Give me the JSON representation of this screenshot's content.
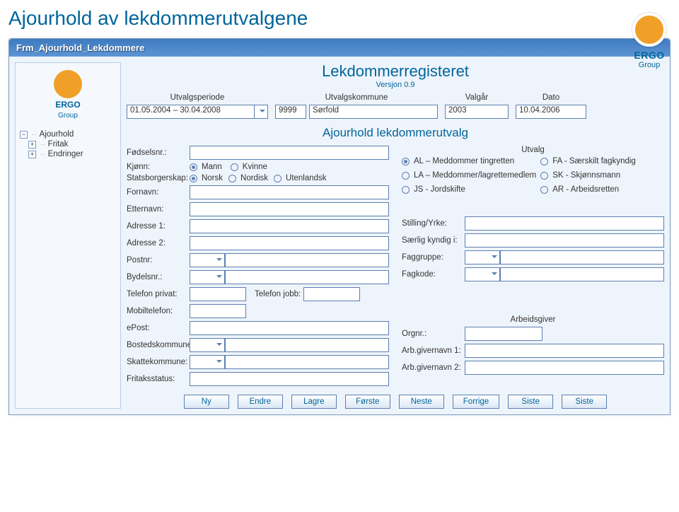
{
  "page": {
    "title": "Ajourhold av lekdommerutvalgene"
  },
  "brand": {
    "name": "ΕRGO",
    "sub": "Group"
  },
  "window": {
    "title": "Frm_Ajourhold_Lekdommere"
  },
  "app": {
    "title": "Lekdommerregisteret",
    "version": "Versjon 0.9"
  },
  "tree": {
    "root": "Ajourhold",
    "n1": "Fritak",
    "n2": "Endringer"
  },
  "header": {
    "labels": {
      "periode": "Utvalgsperiode",
      "kommune": "Utvalgskommune",
      "valgar": "Valgår",
      "dato": "Dato"
    },
    "values": {
      "periode": "01.05.2004 – 30.04.2008",
      "kommune_code": "9999",
      "kommune_name": "Sørfold",
      "valgar": "2003",
      "dato": "10.04.2006"
    }
  },
  "section": {
    "title": "Ajourhold lekdommerutvalg"
  },
  "utvalg": {
    "label": "Utvalg",
    "opts": {
      "al": "AL – Meddommer tingretten",
      "la": "LA – Meddommer/lagrettemedlem",
      "js": "JS - Jordskifte",
      "fa": "FA - Særskilt fagkyndig",
      "sk": "SK - Skjønnsmann",
      "ar": "AR - Arbeidsretten"
    }
  },
  "fields": {
    "fodselsnr": "Fødselsnr.:",
    "kjonn": "Kjønn:",
    "kjonn_mann": "Mann",
    "kjonn_kvinne": "Kvinne",
    "stats": "Statsborgerskap:",
    "stats_norsk": "Norsk",
    "stats_nordisk": "Nordisk",
    "stats_utl": "Utenlandsk",
    "fornavn": "Fornavn:",
    "etternavn": "Etternavn:",
    "adr1": "Adresse 1:",
    "adr2": "Adresse 2:",
    "postnr": "Postnr:",
    "bydel": "Bydelsnr.:",
    "telpriv": "Telefon privat:",
    "teljobb": "Telefon jobb:",
    "mobil": "Mobiltelefon:",
    "epost": "ePost:",
    "bosted": "Bostedskommune:",
    "skatte": "Skattekommune:",
    "fritak": "Fritaksstatus:",
    "stilling": "Stilling/Yrke:",
    "saerlig": "Særlig kyndig i:",
    "faggruppe": "Faggruppe:",
    "fagkode": "Fagkode:",
    "arbeidsgiver": "Arbeidsgiver",
    "orgnr": "Orgnr.:",
    "arbg1": "Arb.givernavn 1:",
    "arbg2": "Arb.givernavn 2:"
  },
  "buttons": {
    "ny": "Ny",
    "endre": "Endre",
    "lagre": "Lagre",
    "forste": "Første",
    "neste": "Neste",
    "forrige": "Forrige",
    "siste": "Siste",
    "siste2": "Siste"
  }
}
